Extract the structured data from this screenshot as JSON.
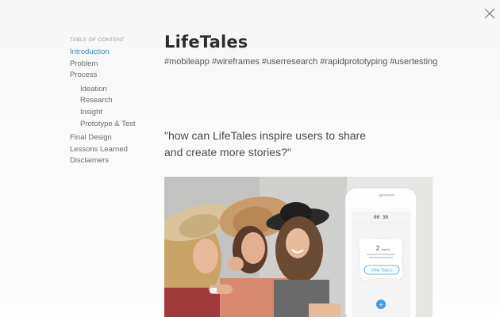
{
  "toc": {
    "heading": "TABLE OF CONTENT",
    "items": [
      {
        "label": "Introduction"
      },
      {
        "label": "Problem"
      },
      {
        "label": "Process"
      },
      {
        "label": "Ideation"
      },
      {
        "label": "Research"
      },
      {
        "label": "Insight"
      },
      {
        "label": "Prototype & Test"
      },
      {
        "label": "Final Design"
      },
      {
        "label": "Lessons Learned"
      },
      {
        "label": "Disclaimers"
      }
    ]
  },
  "page": {
    "title": "LifeTales",
    "tags": "#mobileapp #wireframes #userresearch #rapidprototyping #usertesting",
    "quote": "\"how can LifeTales inspire users to share and create more stories?\""
  },
  "phone": {
    "timer": "00 30",
    "topics_count": "2",
    "topics_word": "topics",
    "button_label": "View Topics",
    "add_symbol": "+"
  },
  "colors": {
    "accent": "#3b8fb5",
    "phone_button": "#3f9be8",
    "text_dark": "#2c2c2c",
    "text_muted": "#6a6a6a"
  },
  "icons": {
    "close": "close-icon",
    "add": "plus-icon"
  }
}
